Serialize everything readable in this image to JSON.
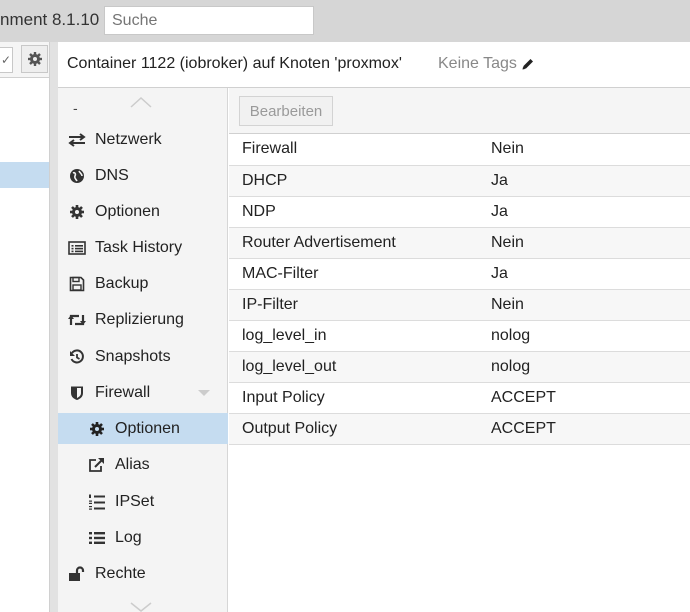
{
  "app": {
    "title_fragment": "nment 8.1.10",
    "search_placeholder": "Suche"
  },
  "header": {
    "title": "Container 1122 (iobroker) auf Knoten 'proxmox'",
    "tags": "Keine Tags"
  },
  "nav": {
    "dash": "-",
    "items": [
      {
        "label": "Netzwerk",
        "icon": "exchange-icon"
      },
      {
        "label": "DNS",
        "icon": "globe-icon"
      },
      {
        "label": "Optionen",
        "icon": "gear-icon"
      },
      {
        "label": "Task History",
        "icon": "list-alt-icon"
      },
      {
        "label": "Backup",
        "icon": "floppy-icon"
      },
      {
        "label": "Replizierung",
        "icon": "retweet-icon"
      },
      {
        "label": "Snapshots",
        "icon": "history-icon"
      },
      {
        "label": "Firewall",
        "icon": "shield-icon"
      },
      {
        "label": "Optionen",
        "icon": "gear-icon",
        "selected": true
      },
      {
        "label": "Alias",
        "icon": "external-link-icon"
      },
      {
        "label": "IPSet",
        "icon": "list-ol-icon"
      },
      {
        "label": "Log",
        "icon": "list-icon"
      },
      {
        "label": "Rechte",
        "icon": "unlock-icon"
      }
    ]
  },
  "toolbar": {
    "edit_label": "Bearbeiten"
  },
  "options": [
    {
      "key": "Firewall",
      "value": "Nein"
    },
    {
      "key": "DHCP",
      "value": "Ja"
    },
    {
      "key": "NDP",
      "value": "Ja"
    },
    {
      "key": "Router Advertisement",
      "value": "Nein"
    },
    {
      "key": "MAC-Filter",
      "value": "Ja"
    },
    {
      "key": "IP-Filter",
      "value": "Nein"
    },
    {
      "key": "log_level_in",
      "value": "nolog"
    },
    {
      "key": "log_level_out",
      "value": "nolog"
    },
    {
      "key": "Input Policy",
      "value": "ACCEPT"
    },
    {
      "key": "Output Policy",
      "value": "ACCEPT"
    }
  ],
  "colors": {
    "selection": "#c5dcf0",
    "topbar": "#d6d6d6",
    "nav_bg": "#f4f4f4"
  }
}
